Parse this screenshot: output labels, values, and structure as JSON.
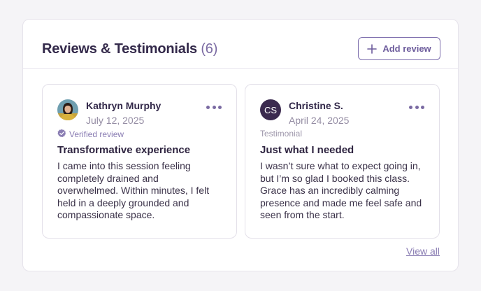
{
  "header": {
    "title": "Reviews & Testimonials",
    "count": "(6)",
    "add_label": "Add review"
  },
  "reviews": [
    {
      "name": "Kathryn Murphy",
      "date": "July 12, 2025",
      "avatar": "photo",
      "tag": "Verified review",
      "title": "Transformative experience",
      "lines": [
        "I came into this session feeling",
        "completely drained and",
        "overwhelmed. Within minutes, I felt",
        "held in a deeply grounded and",
        "compassionate space."
      ]
    },
    {
      "name": "Christine S.",
      "date": "April 24, 2025",
      "avatar_initials": "CS",
      "tag": "Testimonial",
      "title": "Just what I needed",
      "lines": [
        "I wasn’t sure what to expect going in,",
        "but I’m so glad I booked this class.",
        "Grace has an incredibly calming",
        "presence and made me feel safe and",
        "seen from the start."
      ]
    }
  ],
  "footer": {
    "view_all": "View all"
  },
  "colors": {
    "accent": "#7a6aa2",
    "title": "#33294a",
    "avatar_dark": "#3b2a4f"
  },
  "icons": [
    "plus-icon",
    "more-horizontal-icon",
    "verified-check-icon",
    "avatar-photo"
  ]
}
